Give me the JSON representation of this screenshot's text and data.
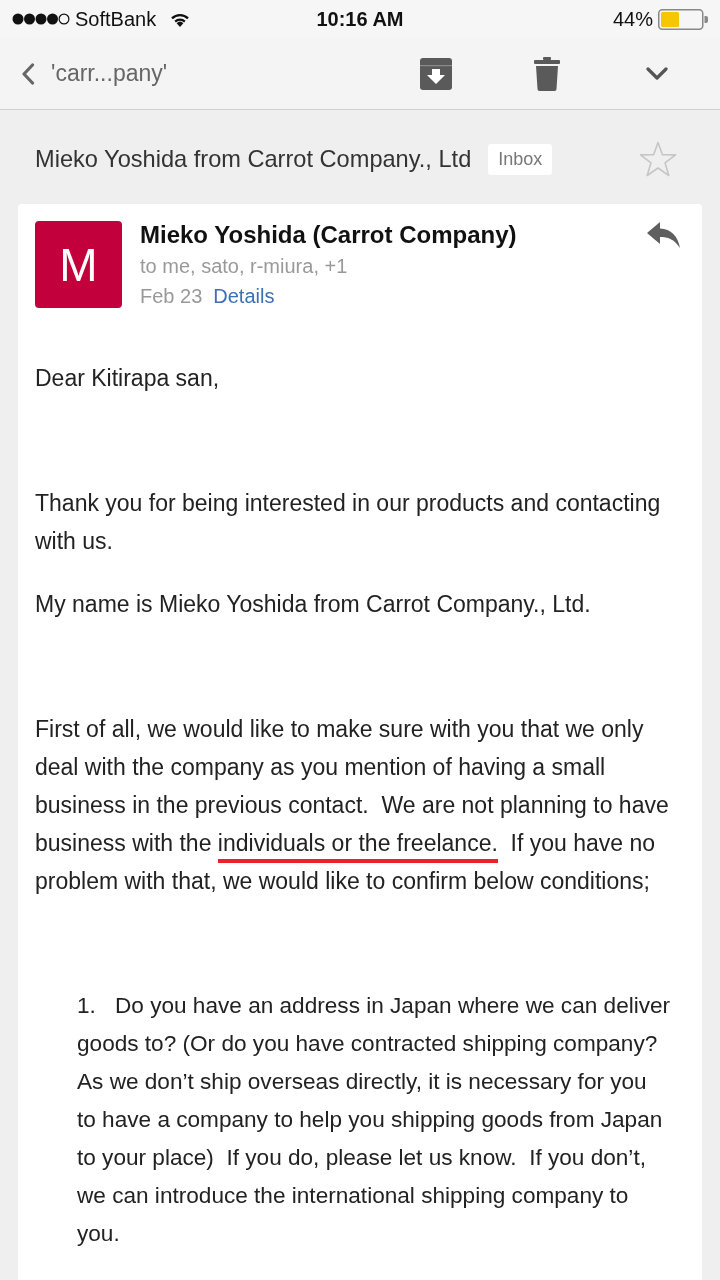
{
  "status_bar": {
    "carrier": "SoftBank",
    "time": "10:16 AM",
    "battery": "44%"
  },
  "nav_bar": {
    "back_label": "'carr...pany'"
  },
  "subject": {
    "title": "Mieko Yoshida from Carrot Company., Ltd",
    "label": "Inbox",
    "starred": false
  },
  "message": {
    "avatar_letter": "M",
    "sender": "Mieko Yoshida (Carrot Company)",
    "recipients": "to me, sato, r-miura, +1",
    "date": "Feb 23",
    "details_link": "Details",
    "body": [
      [
        {
          "kind": "paragraph",
          "runs": [
            {
              "text": "Dear Kitirapa san,",
              "underlined": false
            }
          ]
        }
      ],
      [
        {
          "kind": "paragraph",
          "runs": [
            {
              "text": "Thank you for being interested in our products and contacting with us.",
              "underlined": false
            }
          ]
        },
        {
          "kind": "paragraph",
          "runs": [
            {
              "text": "My name is Mieko Yoshida from Carrot Company., Ltd.",
              "underlined": false
            }
          ]
        }
      ],
      [
        {
          "kind": "paragraph",
          "runs": [
            {
              "text": "First of all, we would like to make sure with you that we only deal with the company as you mention of having a small business in the previous contact.  We are not planning to have business with the ",
              "underlined": false
            },
            {
              "text": "individuals or the freelance.",
              "underlined": true
            },
            {
              "text": "  If you have no problem with that, we would like to confirm below conditions;",
              "underlined": false
            }
          ]
        }
      ],
      [
        {
          "kind": "list_item",
          "number": "1.",
          "runs": [
            {
              "text": "Do you have an address in Japan where we can deliver goods to? (Or do you have contracted shipping company?  As we don’t ship overseas directly, it is necessary for you to have a company to help you shipping goods from Japan to your place)  If you do, please let us know.  If you don’t, we can introduce the international shipping company to you.",
              "underlined": false
            }
          ]
        }
      ]
    ]
  }
}
